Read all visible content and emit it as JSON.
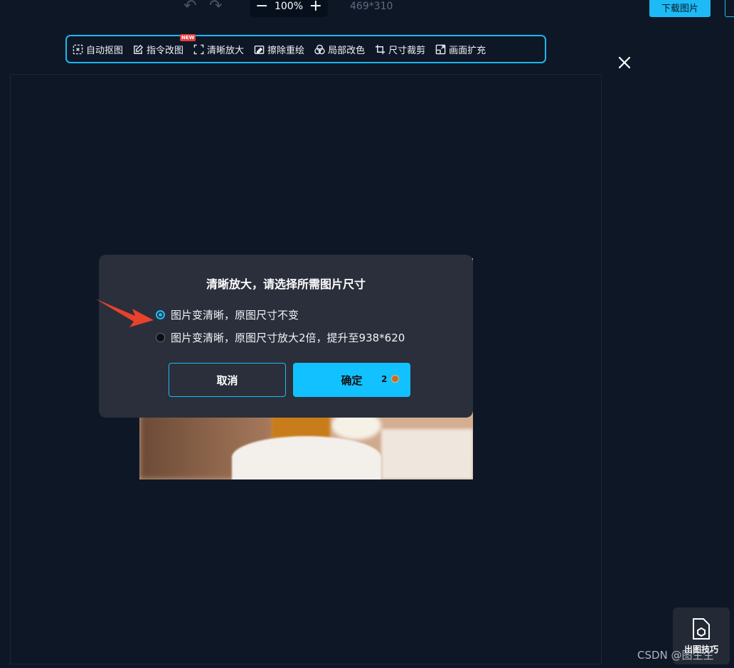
{
  "topbar": {
    "undo_icon": "undo-icon",
    "redo_icon": "redo-icon",
    "zoom_minus": "−",
    "zoom_value": "100%",
    "zoom_plus": "+",
    "dimensions": "469*310",
    "download_label": "下载图片"
  },
  "toolbar": {
    "items": [
      {
        "label": "自动抠图",
        "icon": "auto-cutout-icon"
      },
      {
        "label": "指令改图",
        "icon": "edit-icon",
        "badge": "NEW"
      },
      {
        "label": "清晰放大",
        "icon": "enlarge-icon"
      },
      {
        "label": "擦除重绘",
        "icon": "eraser-icon"
      },
      {
        "label": "局部改色",
        "icon": "color-icon"
      },
      {
        "label": "尺寸裁剪",
        "icon": "crop-icon"
      },
      {
        "label": "画面扩充",
        "icon": "expand-icon"
      }
    ]
  },
  "dialog": {
    "title": "清晰放大，请选择所需图片尺寸",
    "option1": "图片变清晰，原图尺寸不变",
    "option2": "图片变清晰，原图尺寸放大2倍，提升至938*620",
    "selected_option": 1,
    "cancel_label": "取消",
    "confirm_label": "确定",
    "confirm_cost": "2"
  },
  "tips": {
    "label": "出图技巧",
    "icon": "document-icon"
  },
  "watermark": "CSDN @图生生",
  "colors": {
    "accent": "#1dbaf5",
    "background": "#0e1726",
    "dialog": "#2a2f3b",
    "arrow": "#e8412c"
  }
}
